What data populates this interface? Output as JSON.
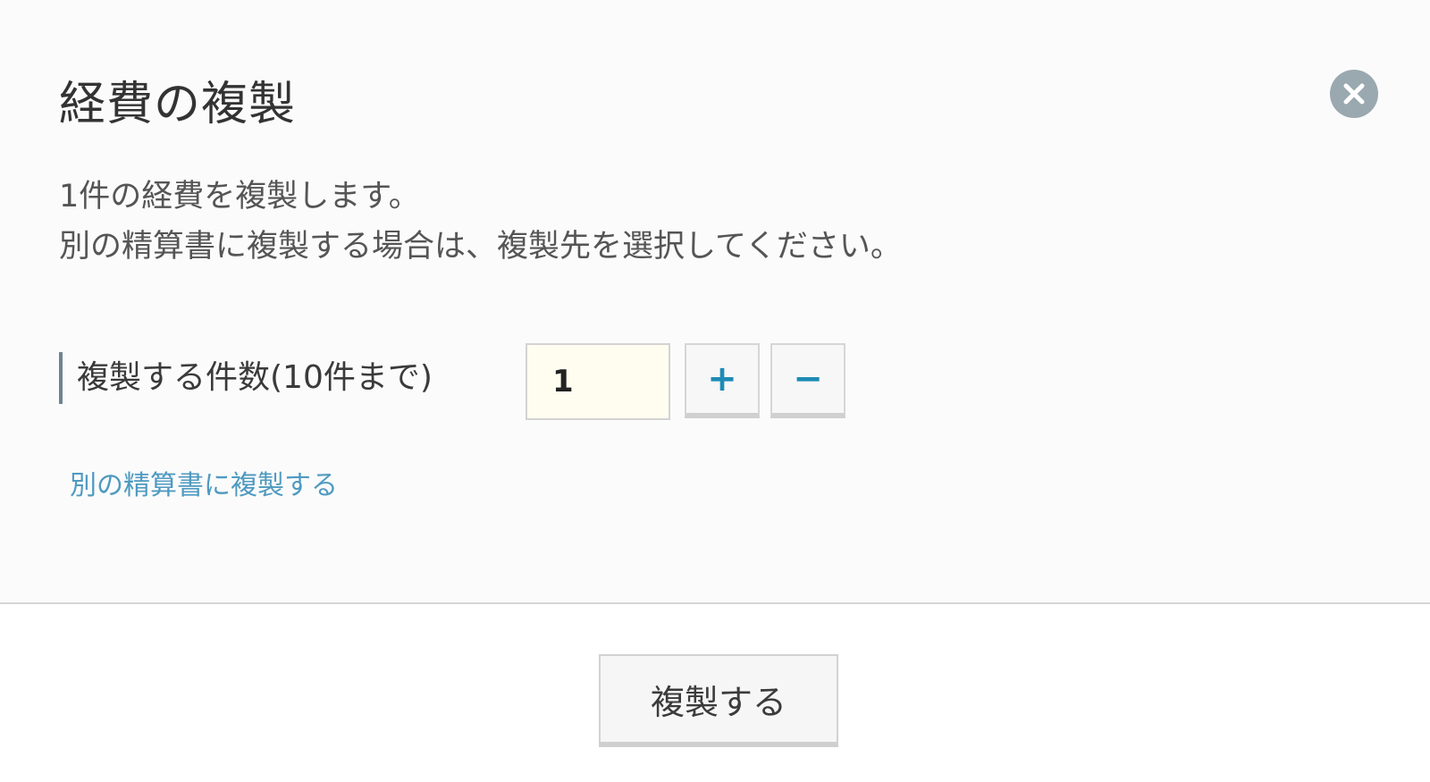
{
  "dialog": {
    "title": "経費の複製",
    "description_line1": "1件の経費を複製します。",
    "description_line2": "別の精算書に複製する場合は、複製先を選択してください。",
    "count_label": "複製する件数(10件まで)",
    "count_value": "1",
    "plus_label": "+",
    "minus_label": "−",
    "alt_link": "別の精算書に複製する",
    "submit_label": "複製する",
    "close_icon": "close-icon"
  },
  "colors": {
    "accent": "#1d8bb5",
    "link": "#4f9ac0",
    "close_bg": "#9aa8b0",
    "input_bg": "#fffdf0"
  }
}
